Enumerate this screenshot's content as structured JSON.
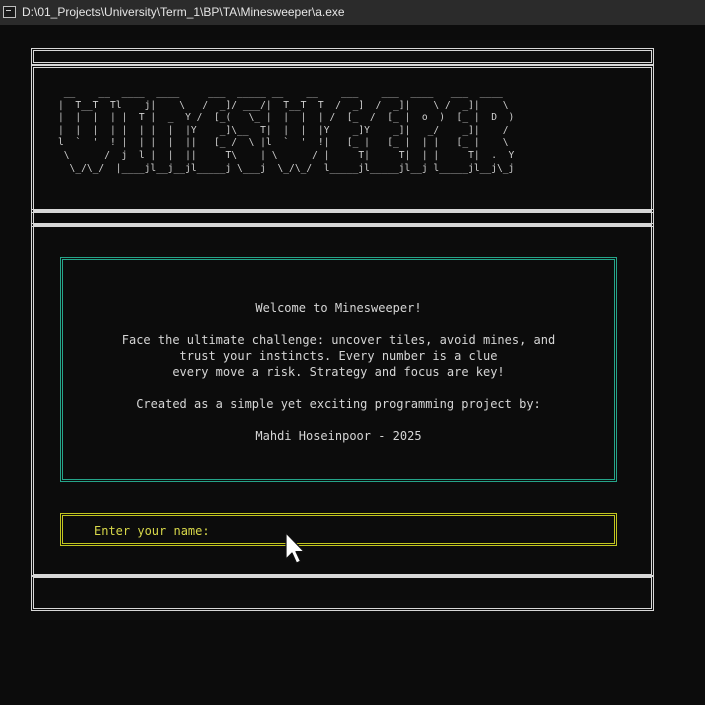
{
  "window": {
    "title": "D:\\01_Projects\\University\\Term_1\\BP\\TA\\Minesweeper\\a.exe"
  },
  "logo": {
    "lines": [
      " __    __  ____  ____     ___  _____ __    __    ___    ___  ____   ___  ____  ",
      "|  T__T  Tl    j|    \\   /  _]/ ___/|  T__T  T  /  _]  /  _]|    \\ /  _]|    \\ ",
      "|  |  |  | |  T |  _  Y /  [_(   \\_ |  |  |  | /  [_  /  [_ |  o  )  [_ |  D  )",
      "|  |  |  | |  | |  |  |Y    _]\\__  T|  |  |  |Y    _]Y    _]|   _/    _]|    / ",
      "l  `  '  ! |  | |  |  ||   [_ /  \\ |l  `  '  !|   [_ |   [_ |  | |   [_ |    \\ ",
      " \\      /  j  l |  |  ||     T\\    | \\      / |     T|     T|  | |     T|  .  Y",
      "  \\_/\\_/  |____jl__j__jl_____j \\___j  \\_/\\_/  l_____jl_____jl__j l_____jl__j\\_j"
    ]
  },
  "info": {
    "lines": [
      "Welcome to Minesweeper!",
      "",
      "Face the ultimate challenge: uncover tiles, avoid mines, and",
      "trust your instincts. Every number is a clue",
      "every move a risk. Strategy and focus are key!",
      "",
      "Created as a simple yet exciting programming project by:",
      "",
      "Mahdi Hoseinpoor - 2025"
    ]
  },
  "prompt": {
    "label": "Enter your name:",
    "value": ""
  },
  "colors": {
    "info_border": "#25a58a",
    "prompt_border": "#c2c51f",
    "prompt_text": "#d8d84a",
    "frame": "#d8d8d8"
  }
}
